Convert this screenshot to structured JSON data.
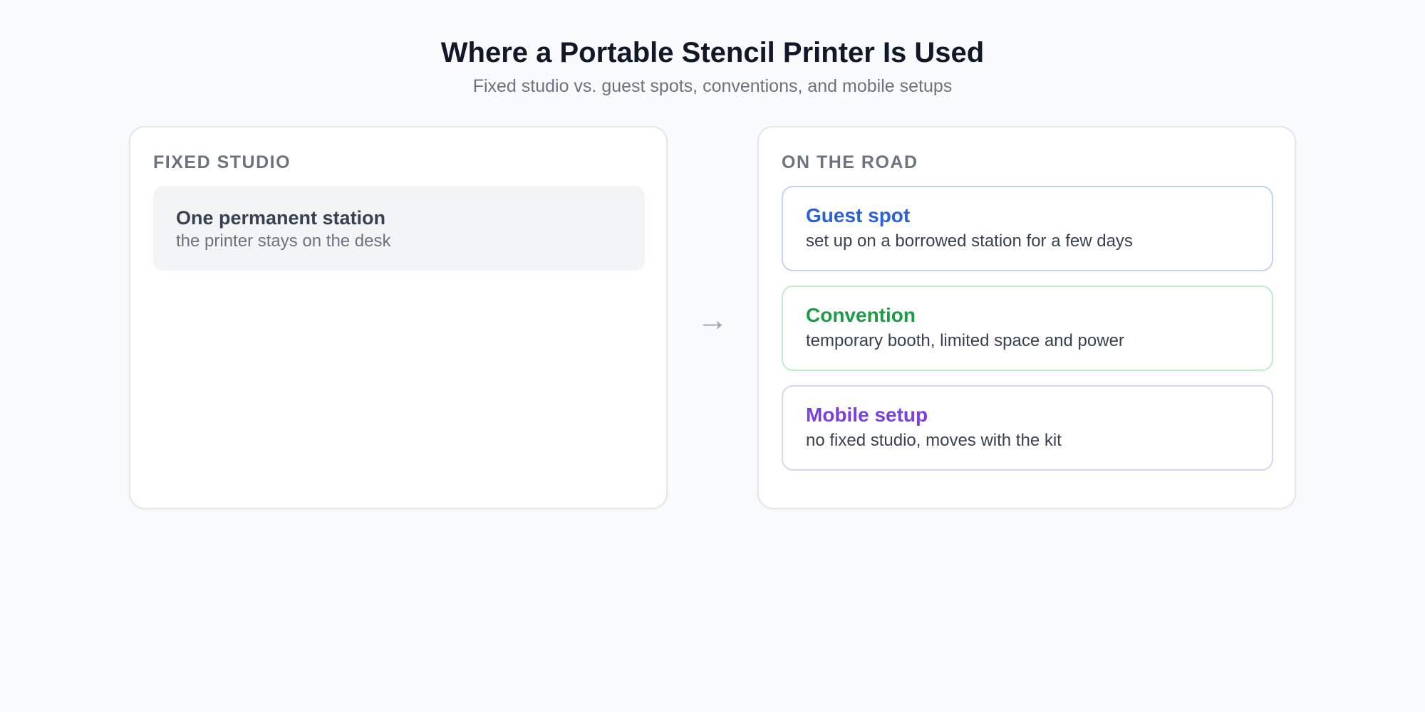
{
  "header": {
    "title": "Where a Portable Stencil Printer Is Used",
    "subtitle": "Fixed studio vs. guest spots, conventions, and mobile setups"
  },
  "fixed_studio": {
    "heading": "FIXED STUDIO",
    "station": {
      "title": "One permanent station",
      "description": "the printer stays on the desk"
    }
  },
  "connector": {
    "glyph": "→",
    "icon": "arrow-right-icon"
  },
  "on_the_road": {
    "heading": "ON THE ROAD",
    "items": [
      {
        "title": "Guest spot",
        "description": "set up on a borrowed station for a few days",
        "accent": "#2b63d6",
        "border": "#bfd3f3"
      },
      {
        "title": "Convention",
        "description": "temporary booth, limited space and power",
        "accent": "#1e9a46",
        "border": "#bbf0cb"
      },
      {
        "title": "Mobile setup",
        "description": "no fixed studio, moves with the kit",
        "accent": "#7b3ee0",
        "border": "#d8d4f2"
      }
    ]
  }
}
